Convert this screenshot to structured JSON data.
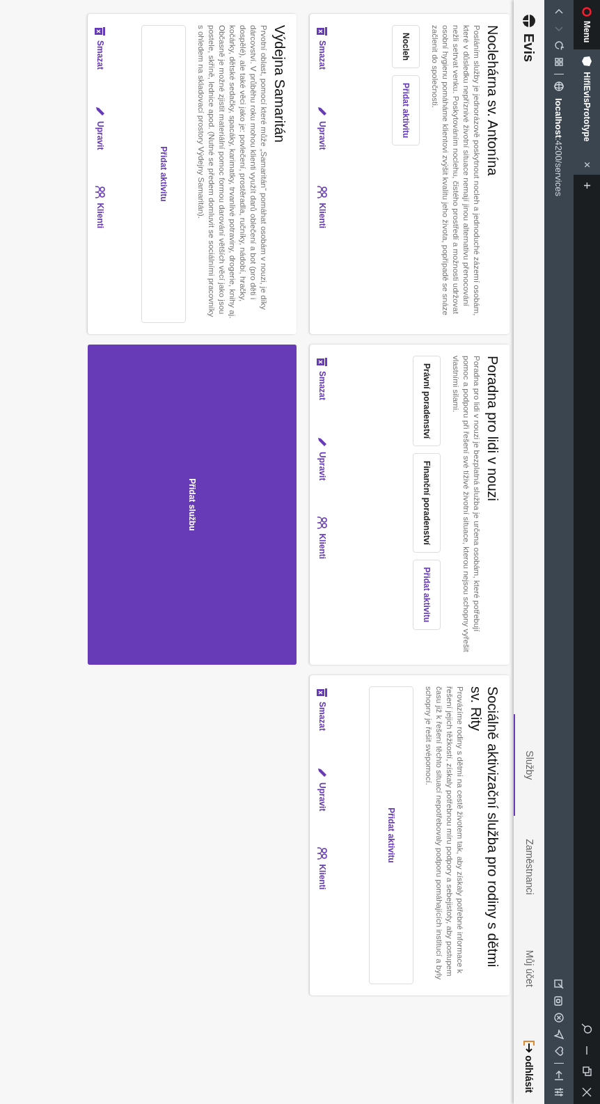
{
  "browser": {
    "menu": "Menu",
    "tab": {
      "title": "HifiEvisPrototype",
      "close": "×"
    },
    "new_tab": "+",
    "address": "**localhost**:4200/services"
  },
  "app": {
    "logo": "Evis",
    "nav": [
      {
        "label": "Služby",
        "selected": true
      },
      {
        "label": "Zaměstnanci",
        "selected": false
      },
      {
        "label": "Můj účet",
        "selected": false
      }
    ],
    "logout": "odhlásit"
  },
  "services": [
    {
      "title": "Noclehárna sv. Antonína",
      "description": "Posláním služby je jednorázově poskytnout nocleh a jednoduché zázemí osobám, které v důsledku nepříznivé životní situace nemají jinou alternativu přenocování nežli setrvat venku. Poskytováním noclehu, čistého prostředí a možnosti udržovat osobní hygienu pomáháme klientovi zvýšit kvalitu jeho života, popřípadě se snáze začlenit do společnosti.",
      "activities": [
        "Nocleh"
      ],
      "add_activity": "Přidat aktivitu",
      "actions": [
        {
          "kind": "delete",
          "label": "Smazat"
        },
        {
          "kind": "edit",
          "label": "Upravit"
        },
        {
          "kind": "clients",
          "label": "Klienti"
        }
      ]
    },
    {
      "title": "Poradna pro lidi v nouzi",
      "description": "Poradna pro lidi v nouzi je bezplatná služba je určena osobám, které potřebují pomoc a podporu při řešení své tíživé životní situace, kterou nejsou schopny vyřešit vlastními silami.",
      "activities": [
        "Právní poradenství",
        "Finanční poradenství"
      ],
      "add_activity": "Přidat aktivitu",
      "actions": [
        {
          "kind": "delete",
          "label": "Smazat"
        },
        {
          "kind": "edit",
          "label": "Upravit"
        },
        {
          "kind": "clients",
          "label": "Klienti"
        }
      ]
    },
    {
      "title": "Sociálně aktivizační služba pro rodiny s dětmi sv. Rity",
      "description": "Provázíme rodiny s dětmi na cestě životem tak, aby získaly potřebné informace k řešení jejich těžkostí, získaly potřebnou míru podpory a sebejistoty, aby postupem času již k řešení těchto situací nepotřebovaly podporu pomáhajících institucí a byly schopny je řešit svépomocí.",
      "add_activity": "Přidat aktivitu",
      "actions": [
        {
          "kind": "delete",
          "label": "Smazat"
        },
        {
          "kind": "edit",
          "label": "Upravit"
        },
        {
          "kind": "clients",
          "label": "Klienti"
        }
      ]
    },
    {
      "title": "Výdejna Samaritán",
      "description": "Prvotní oblast, pomocí které může „Samaritán“ pomáhat osobám v nouzi, je díky dárcovství. V průběhu roku mohou klienti využít darů oblečení a bot (pro děti i dospělé), ale také věci jako je: povlečení, prostěradla, ručníky, nádobí, hračky, kočárky, dětské sedačky, spacáky, karimatky, trvanlivé potraviny, drogerie, knihy aj. Občasně je možné zjistit materiální pomoc formou darování větších věcí jako jsou postele, skříně, lednice apod. (Nutné se předem domluvit se sociálními pracovníky s ohledem na skladovací prostory Výdejny Samaritán).",
      "add_activity": "Přidat aktivitu",
      "actions": [
        {
          "kind": "delete",
          "label": "Smazat"
        },
        {
          "kind": "edit",
          "label": "Upravit"
        },
        {
          "kind": "clients",
          "label": "Klienti"
        }
      ]
    }
  ],
  "add_service": "Přidat službu"
}
